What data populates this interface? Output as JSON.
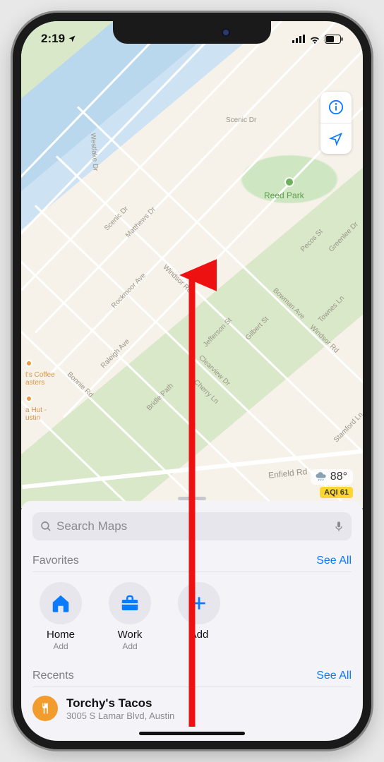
{
  "status": {
    "time": "2:19"
  },
  "map": {
    "park_label": "Reed Park",
    "streets": {
      "westlake": "Westlake Dr",
      "scenic1": "Scenic Dr",
      "scenic2": "Scenic Dr",
      "matthews": "Matthews Dr",
      "rockmoor": "Rockmoor Ave",
      "raleigh": "Raleigh Ave",
      "bridle": "Bridle Path",
      "bonnie": "Bonnie Rd",
      "windsor": "Windsor Rd",
      "clearview": "Clearview Dr",
      "cherry": "Cherry Ln",
      "jefferson": "Jefferson St",
      "pecos": "Pecos St",
      "greenlee": "Greenlee Dr",
      "bowman": "Bowman Ave",
      "townes": "Townes Ln",
      "gilbert": "Gilbert St",
      "windsor2": "Windsor Rd",
      "stamford": "Stamford Ln",
      "enfield": "Enfield Rd"
    },
    "poi_coffee": "t's Coffee\nasters",
    "poi_hut": "a Hut -\nustin",
    "weather": {
      "temp": "88°",
      "aqi": "AQI 61"
    }
  },
  "search": {
    "placeholder": "Search Maps"
  },
  "favorites": {
    "title": "Favorites",
    "see_all": "See All",
    "items": [
      {
        "name": "Home",
        "sub": "Add"
      },
      {
        "name": "Work",
        "sub": "Add"
      },
      {
        "name": "Add",
        "sub": ""
      }
    ]
  },
  "recents": {
    "title": "Recents",
    "see_all": "See All",
    "items": [
      {
        "title": "Torchy's Tacos",
        "sub": "3005 S Lamar Blvd, Austin"
      }
    ]
  }
}
